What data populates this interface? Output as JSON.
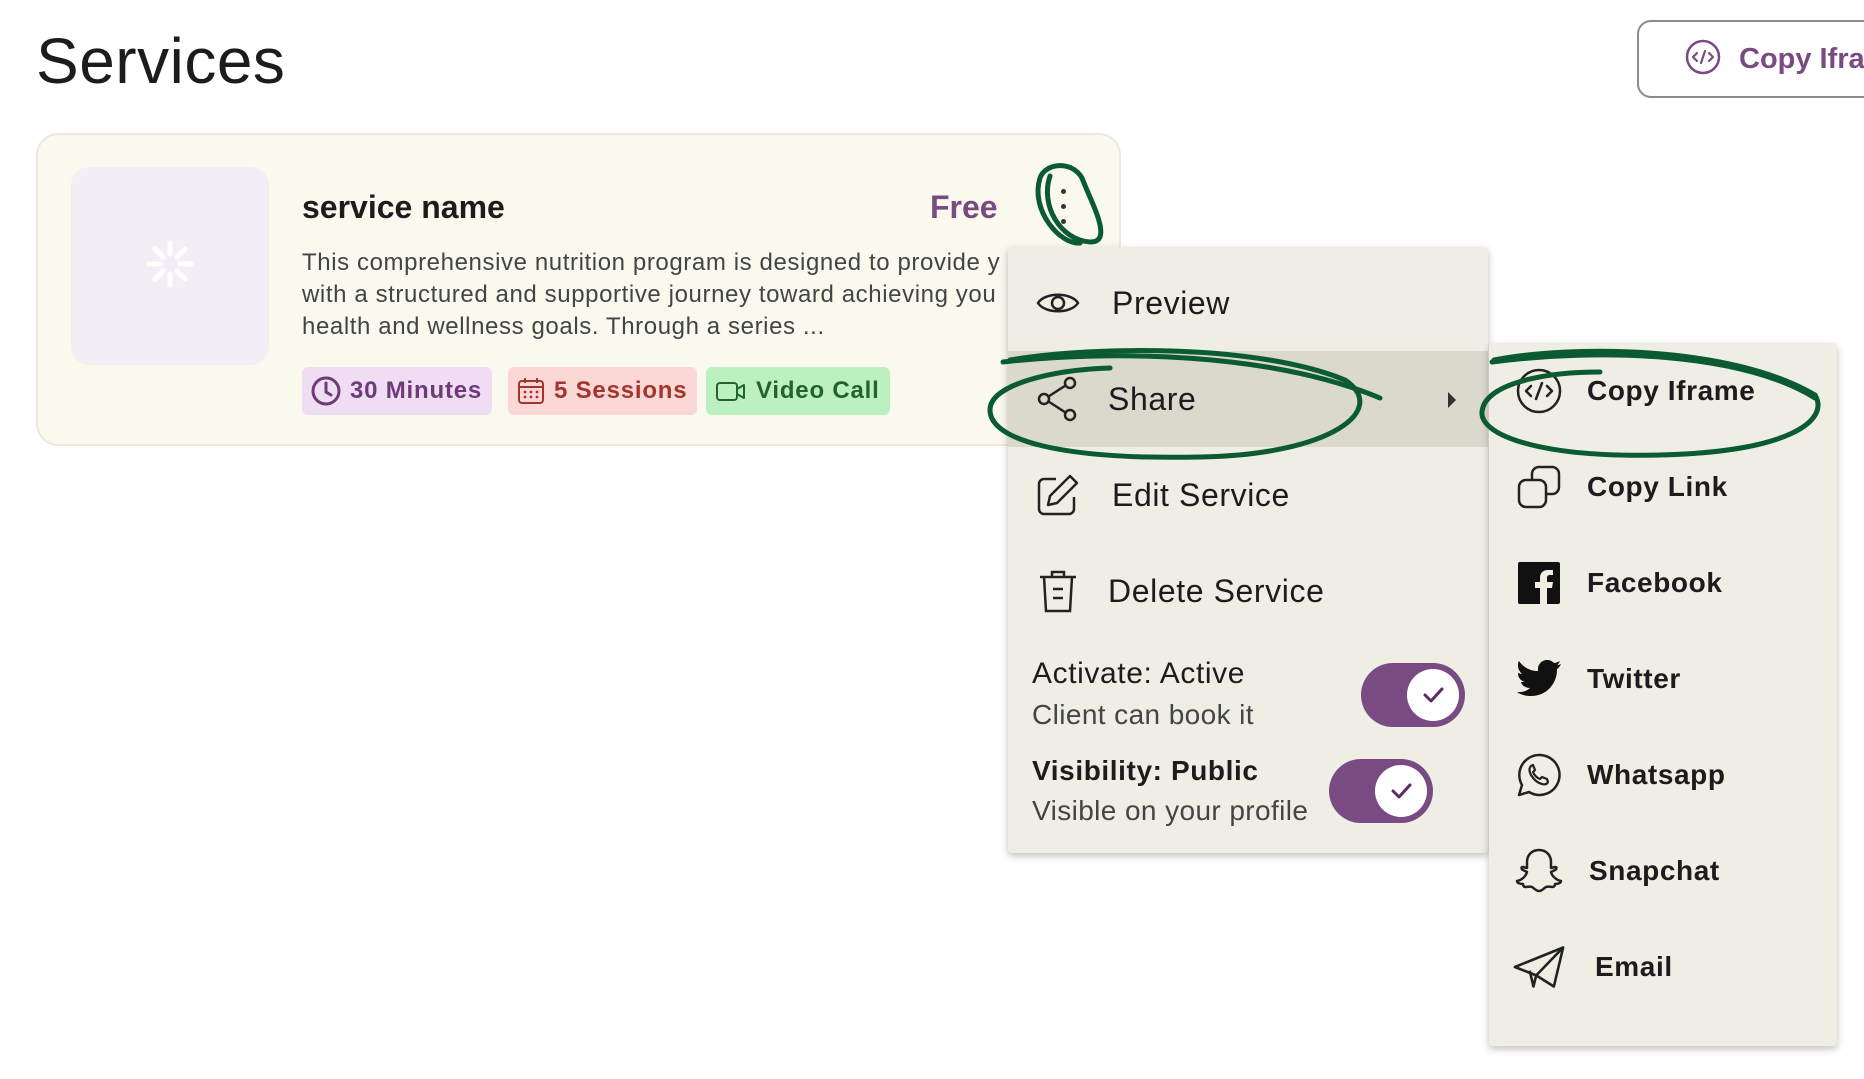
{
  "page": {
    "title": "Services"
  },
  "header": {
    "copy_iframe_label": "Copy Iframe"
  },
  "service": {
    "name": "service name",
    "price": "Free",
    "description_lines": [
      "This comprehensive nutrition program is designed to provide y",
      "with a structured and supportive journey toward achieving you",
      "health and wellness goals. Through a series ..."
    ],
    "chips": {
      "duration": "30 Minutes",
      "sessions": "5 Sessions",
      "call": "Video Call"
    }
  },
  "menu": {
    "preview": "Preview",
    "share": "Share",
    "edit": "Edit Service",
    "delete": "Delete Service",
    "activate_title": "Activate: Active",
    "activate_sub": "Client can book it",
    "visibility_title": "Visibility: Public",
    "visibility_sub": "Visible on your profile"
  },
  "share_menu": {
    "items": [
      "Copy Iframe",
      "Copy Link",
      "Facebook",
      "Twitter",
      "Whatsapp",
      "Snapchat",
      "Email"
    ]
  },
  "colors": {
    "accent": "#7a4b83",
    "annotation": "#0b5b32",
    "menu_bg": "#efeee4"
  }
}
